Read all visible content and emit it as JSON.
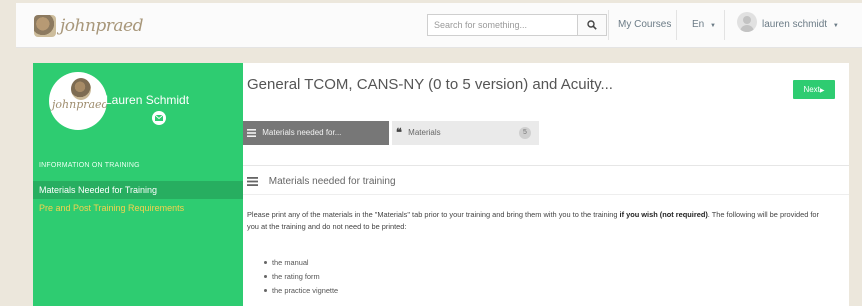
{
  "header": {
    "logo_text": "johnpraed",
    "search": {
      "placeholder": "Search for something..."
    },
    "nav": {
      "my_courses": "My Courses",
      "language": "En",
      "user_name": "lauren schmidt"
    }
  },
  "sidebar": {
    "avatar_text": "johnpraed",
    "profile_name": "Lauren Schmidt",
    "section_label": "INFORMATION ON TRAINING",
    "items": [
      {
        "label": "Materials Needed for Training",
        "active": true
      },
      {
        "label": "Pre and Post Training Requirements",
        "active": false
      }
    ]
  },
  "main": {
    "title": "General TCOM, CANS-NY (0 to 5 version) and Acuity...",
    "next_label": "Next",
    "tabs": [
      {
        "label": "Materials needed for...",
        "icon": "list-icon"
      },
      {
        "label": "Materials",
        "icon": "quote-icon",
        "count": "5"
      }
    ],
    "section_title": "Materials needed for training",
    "body_text_1": "Please print any of the materials in the \"Materials\" tab prior to your training and bring them with you to the training ",
    "body_bold": "if you wish (not required)",
    "body_text_2": ".  The following will be provided for you at the training and do not need to be printed:",
    "bullets": [
      "the manual",
      "the rating form",
      "the practice vignette"
    ]
  },
  "colors": {
    "accent_green": "#2ecc71",
    "active_item_green": "#27ae60",
    "inactive_item_yellow": "#f4d24e"
  }
}
